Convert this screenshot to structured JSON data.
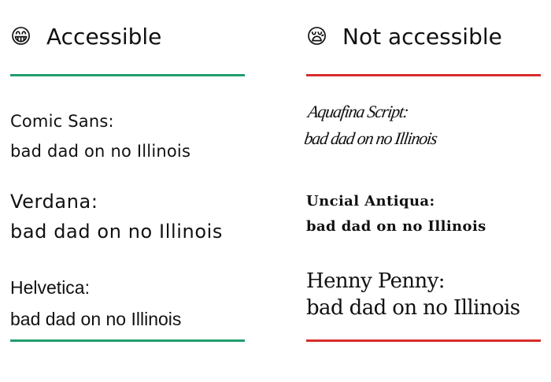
{
  "accessible": {
    "emoji": "😁",
    "title": "Accessible",
    "rule_color": "#1f9e6e",
    "samples": [
      {
        "font_name": "Comic Sans:",
        "text": "bad dad on no Illinois"
      },
      {
        "font_name": "Verdana:",
        "text": "bad dad on no Illinois"
      },
      {
        "font_name": "Helvetica:",
        "text": "bad dad on no Illinois"
      }
    ]
  },
  "not_accessible": {
    "emoji": "😪",
    "title": "Not accessible",
    "rule_color": "#d92b2b",
    "samples": [
      {
        "font_name": "Aquafina Script:",
        "text": "bad dad on no Illinois"
      },
      {
        "font_name": "Uncial Antiqua:",
        "text": "bad dad on no Illinois"
      },
      {
        "font_name": "Henny Penny:",
        "text": "bad dad on no Illinois"
      }
    ]
  }
}
